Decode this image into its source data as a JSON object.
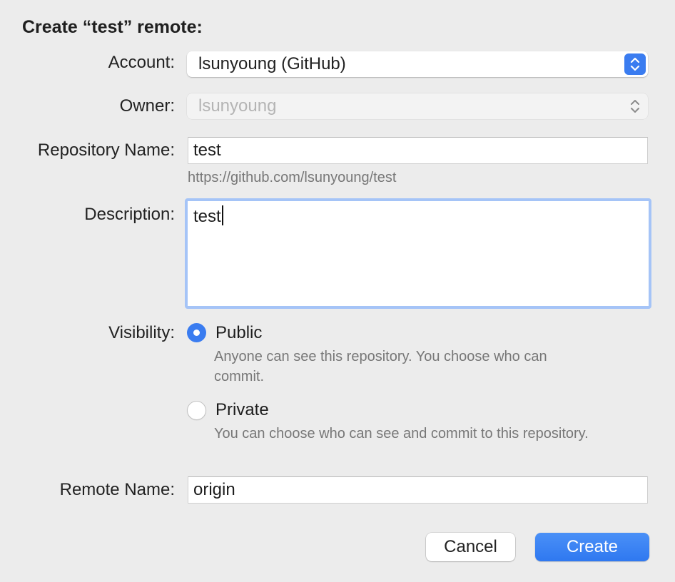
{
  "dialog": {
    "title": "Create “test” remote:"
  },
  "account": {
    "label": "Account:",
    "value": "lsunyoung (GitHub)"
  },
  "owner": {
    "label": "Owner:",
    "value": "lsunyoung"
  },
  "repository": {
    "label": "Repository Name:",
    "value": "test",
    "url_hint": "https://github.com/lsunyoung/test"
  },
  "description": {
    "label": "Description:",
    "value": "test"
  },
  "visibility": {
    "label": "Visibility:",
    "selected": "Public",
    "options": [
      {
        "label": "Public",
        "description": "Anyone can see this repository. You choose who can commit."
      },
      {
        "label": "Private",
        "description": "You can choose who can see and commit to this repository."
      }
    ]
  },
  "remote": {
    "label": "Remote Name:",
    "value": "origin"
  },
  "buttons": {
    "cancel": "Cancel",
    "create": "Create"
  },
  "colors": {
    "accent": "#3a7cf0",
    "focus_ring": "#a5c4f7"
  }
}
